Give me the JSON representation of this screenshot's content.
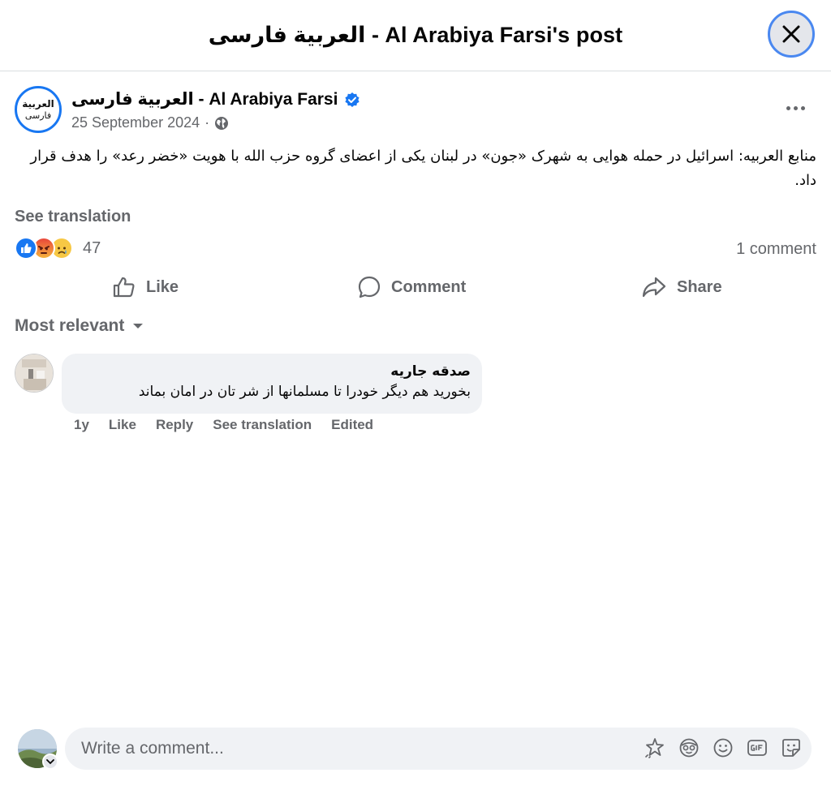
{
  "dialog": {
    "title": "العربية فارسی - Al Arabiya Farsi's post"
  },
  "post": {
    "page_name": "العربية فارسی - Al Arabiya Farsi",
    "avatar_line1": "العربية",
    "avatar_line2": "فارسی",
    "date": "25 September 2024",
    "date_separator": "·",
    "text": "منابع العربیه: اسرائیل در حمله هوایی به شهرک «جون» در لبنان یکی از اعضای گروه حزب الله با هویت «خضر رعد» را هدف قرار داد.",
    "see_translation": "See translation",
    "reaction_count": "47",
    "comment_count": "1 comment"
  },
  "actions": {
    "like": "Like",
    "comment": "Comment",
    "share": "Share"
  },
  "comments_section": {
    "sort_label": "Most relevant",
    "items": [
      {
        "author": "صدقه جاریه",
        "text": "بخورید هم دیگر خودرا تا مسلمانها از شر تان در امان بماند",
        "time": "1y",
        "like": "Like",
        "reply": "Reply",
        "see_translation": "See translation",
        "edited": "Edited"
      }
    ]
  },
  "composer": {
    "placeholder": "Write a comment..."
  },
  "icons": [
    "close-icon",
    "verified-badge-icon",
    "globe-icon",
    "more-icon",
    "like-icon",
    "comment-icon",
    "share-icon",
    "caret-down-icon",
    "sticker-icon",
    "avatar-sticker-icon",
    "emoji-icon",
    "gif-icon",
    "sticker-face-icon"
  ],
  "colors": {
    "accent": "#1877f2",
    "secondary_text": "#65676b",
    "bubble": "#f0f2f5"
  }
}
